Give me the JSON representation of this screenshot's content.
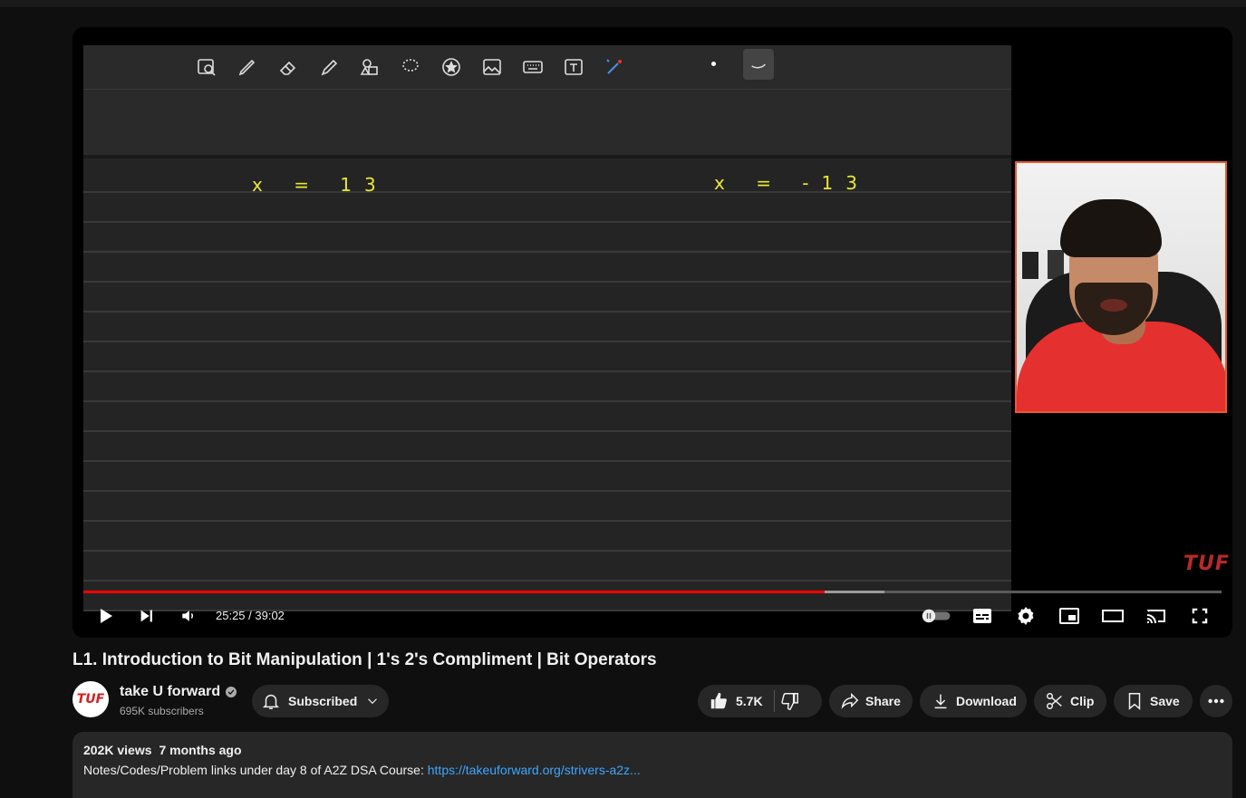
{
  "player": {
    "board": {
      "left_expr": "x = 13",
      "right_expr": "x = -13"
    },
    "watermark": "TUF",
    "progress": {
      "played": 0.651,
      "buffered": 0.704
    },
    "time": {
      "current": "25:25",
      "duration": "39:02",
      "display": "25:25 / 39:02"
    }
  },
  "video": {
    "title": "L1. Introduction to Bit Manipulation | 1's 2's Compliment | Bit Operators"
  },
  "channel": {
    "avatar_text": "TUF",
    "name": "take U forward",
    "subscribers": "695K subscribers"
  },
  "actions": {
    "subscribed": "Subscribed",
    "likes": "5.7K",
    "share": "Share",
    "download": "Download",
    "clip": "Clip",
    "save": "Save"
  },
  "description": {
    "views": "202K views",
    "age": "7 months ago",
    "text": "Notes/Codes/Problem links under day 8 of A2Z DSA Course: ",
    "link": "https://takeuforward.org/strivers-a2z..."
  },
  "colors": {
    "progress": "#ff0000",
    "link": "#3ea6ff",
    "handwriting": "#e8e832"
  }
}
